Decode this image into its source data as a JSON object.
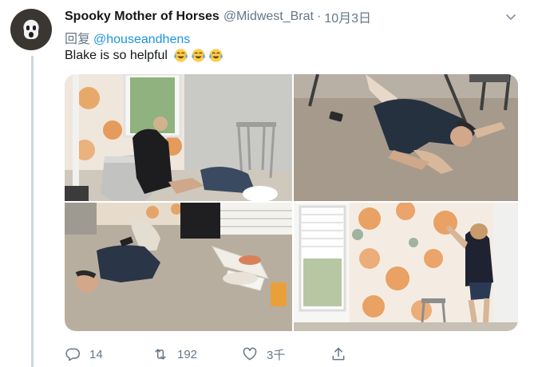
{
  "tweet": {
    "display_name": "Spooky Mother of Horses",
    "handle": "@Midwest_Brat",
    "separator": "·",
    "date": "10月3日",
    "reply_prefix": "回复",
    "reply_to": "@houseandhens",
    "text": "Blake is so helpful",
    "emojis": [
      "face-with-tears-of-joy",
      "face-with-tears-of-joy",
      "face-with-tears-of-joy"
    ]
  },
  "media": {
    "photos": [
      {
        "id": "photo-1",
        "subject": "woman kneeling at wall, man lying on floor"
      },
      {
        "id": "photo-2",
        "subject": "man lying on carpet with hands behind head"
      },
      {
        "id": "photo-3",
        "subject": "man lying on floor next to wallpaper rolls"
      },
      {
        "id": "photo-4",
        "subject": "woman hanging floral wallpaper"
      }
    ]
  },
  "actions": {
    "reply_count": "14",
    "retweet_count": "192",
    "like_count": "3千"
  },
  "colors": {
    "text_primary": "#14171a",
    "text_secondary": "#657786",
    "link": "#1b95e0",
    "thread_line": "#ccd6dd"
  }
}
